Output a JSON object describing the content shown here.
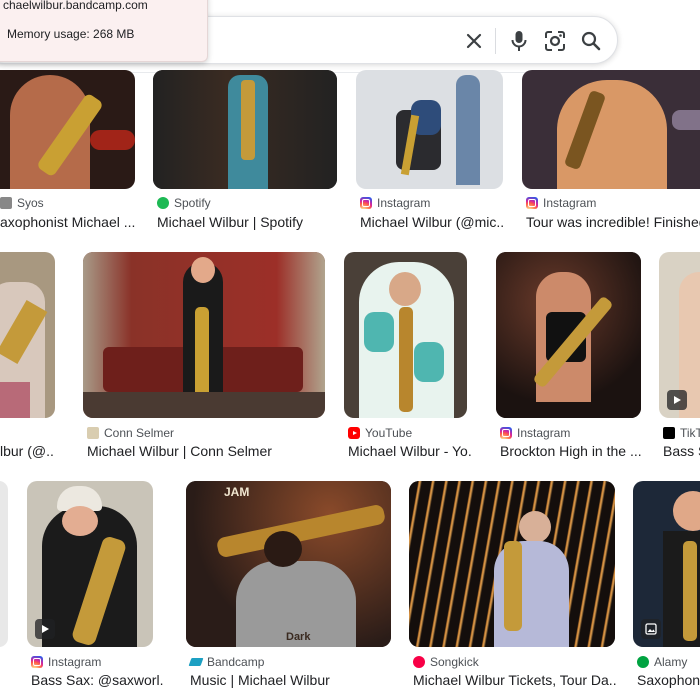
{
  "tooltip": {
    "url": "chaelwilbur.bandcamp.com",
    "memory": "Memory usage: 268 MB"
  },
  "search": {
    "icons": [
      "close-icon",
      "mic-icon",
      "camera-lens-icon",
      "search-icon"
    ]
  },
  "results": [
    {
      "source": "Syos",
      "title": "axophonist Michael ...",
      "favicon": "syos-icon"
    },
    {
      "source": "Spotify",
      "title": "Michael Wilbur | Spotify",
      "favicon": "spotify-icon"
    },
    {
      "source": "Instagram",
      "title": "Michael Wilbur (@mic...",
      "favicon": "instagram-icon"
    },
    {
      "source": "Instagram",
      "title": "Tour was incredible! Finished",
      "favicon": "instagram-icon"
    },
    {
      "source": "",
      "title": "lbur (@...",
      "favicon": ""
    },
    {
      "source": "Conn Selmer",
      "title": "Michael Wilbur | Conn Selmer",
      "favicon": "conn-selmer-icon"
    },
    {
      "source": "YouTube",
      "title": "Michael Wilbur - Yo...",
      "favicon": "youtube-icon"
    },
    {
      "source": "Instagram",
      "title": "Brockton High in the ...",
      "favicon": "instagram-icon"
    },
    {
      "source": "TikT",
      "title": "Bass S",
      "favicon": "tiktok-icon"
    },
    {
      "source": "Instagram",
      "title": "Bass Sax: @saxworl...",
      "favicon": "instagram-icon"
    },
    {
      "source": "Bandcamp",
      "title": "Music | Michael Wilbur",
      "favicon": "bandcamp-icon"
    },
    {
      "source": "Songkick",
      "title": "Michael Wilbur Tickets, Tour Da...",
      "favicon": "songkick-icon"
    },
    {
      "source": "Alamy",
      "title": "Saxophonis",
      "favicon": "alamy-icon"
    }
  ],
  "thumbnail_art": {
    "jam_sign": "JAM",
    "shirt_text": "Dark"
  }
}
